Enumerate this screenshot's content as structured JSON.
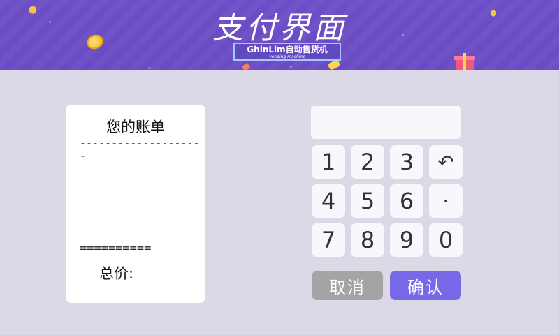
{
  "header": {
    "title": "支付界面",
    "brand": "GhinLim自动售货机",
    "brand_sub": "vending machine"
  },
  "bill": {
    "title": "您的账单",
    "separator_dash": "--------------------",
    "separator_equal": "==========",
    "total_label": "总价:"
  },
  "keypad": {
    "display_value": "",
    "keys": [
      "1",
      "2",
      "3",
      "↶",
      "4",
      "5",
      "6",
      "·",
      "7",
      "8",
      "9",
      "0"
    ]
  },
  "actions": {
    "cancel_label": "取消",
    "confirm_label": "确认"
  },
  "colors": {
    "banner": "#6a4bc3",
    "background": "#dcd8e6",
    "confirm": "#7668e6",
    "cancel": "#a4a4a6"
  }
}
